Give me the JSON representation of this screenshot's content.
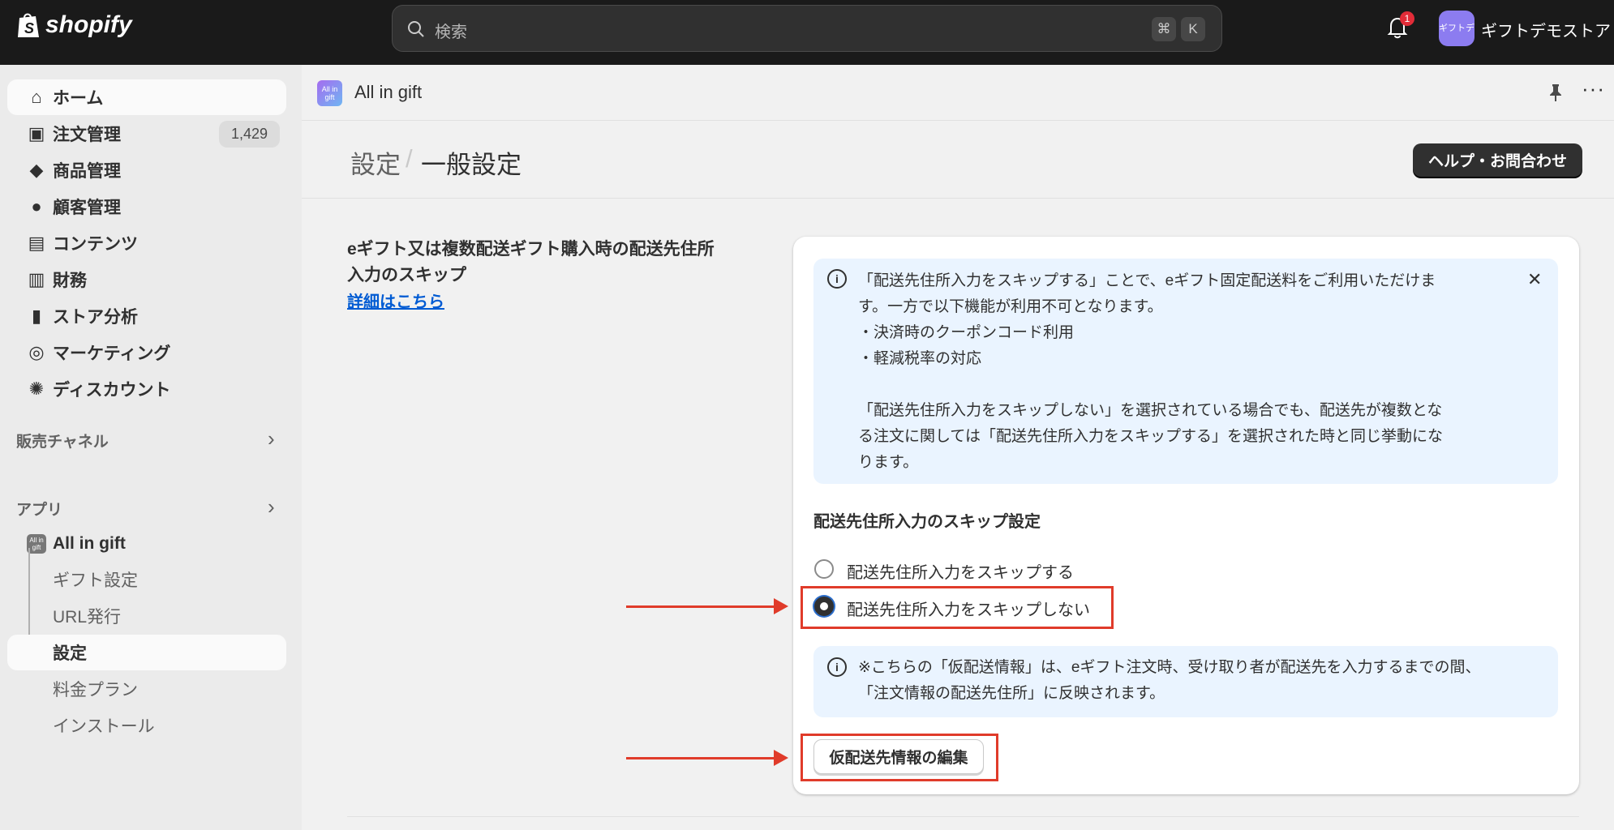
{
  "topbar": {
    "brand": "shopify",
    "search_placeholder": "検索",
    "shortcut": [
      "⌘",
      "K"
    ],
    "notification_count": "1",
    "avatar_text": "ギフトデモ",
    "store_name": "ギフトデモストア"
  },
  "sidebar": {
    "items": [
      {
        "label": "ホーム",
        "icon": "home-icon",
        "active": true
      },
      {
        "label": "注文管理",
        "icon": "inbox-icon",
        "badge": "1,429"
      },
      {
        "label": "商品管理",
        "icon": "tag-icon"
      },
      {
        "label": "顧客管理",
        "icon": "person-icon"
      },
      {
        "label": "コンテンツ",
        "icon": "content-icon"
      },
      {
        "label": "財務",
        "icon": "bank-icon"
      },
      {
        "label": "ストア分析",
        "icon": "bar-chart-icon"
      },
      {
        "label": "マーケティング",
        "icon": "target-icon"
      },
      {
        "label": "ディスカウント",
        "icon": "discount-icon"
      }
    ],
    "sales_channels": "販売チャネル",
    "apps": "アプリ",
    "app_name": "All in gift",
    "app_items": [
      {
        "label": "ギフト設定"
      },
      {
        "label": "URL発行"
      },
      {
        "label": "設定",
        "active": true
      },
      {
        "label": "料金プラン"
      },
      {
        "label": "インストール"
      }
    ]
  },
  "appbar": {
    "title": "All in gift"
  },
  "page": {
    "breadcrumb_parent": "設定",
    "breadcrumb_sep": "/",
    "title": "一般設定",
    "help_button": "ヘルプ・お問合わせ"
  },
  "section": {
    "heading": "eギフト又は複数配送ギフト購入時の配送先住所入力のスキップ",
    "link": "詳細はこちら",
    "banner_lines": [
      "「配送先住所入力をスキップする」ことで、eギフト固定配送料をご利用いただけま",
      "す。一方で以下機能が利用不可となります。",
      "・決済時のクーポンコード利用",
      "・軽減税率の対応",
      "",
      "「配送先住所入力をスキップしない」を選択されている場合でも、配送先が複数とな",
      "る注文に関しては「配送先住所入力をスキップする」を選択された時と同じ挙動にな",
      "ります。"
    ],
    "setting_title": "配送先住所入力のスキップ設定",
    "options": [
      {
        "label": "配送先住所入力をスキップする",
        "selected": false
      },
      {
        "label": "配送先住所入力をスキップしない",
        "selected": true
      }
    ],
    "note_lines": [
      "※こちらの「仮配送情報」は、eギフト注文時、受け取り者が配送先を入力するまでの間、",
      "「注文情報の配送先住所」に反映されます。"
    ],
    "edit_button": "仮配送先情報の編集"
  },
  "colors": {
    "highlight": "#e03b2a",
    "link": "#005bd3",
    "banner": "#eaf4ff",
    "topbar": "#1a1a1a"
  }
}
